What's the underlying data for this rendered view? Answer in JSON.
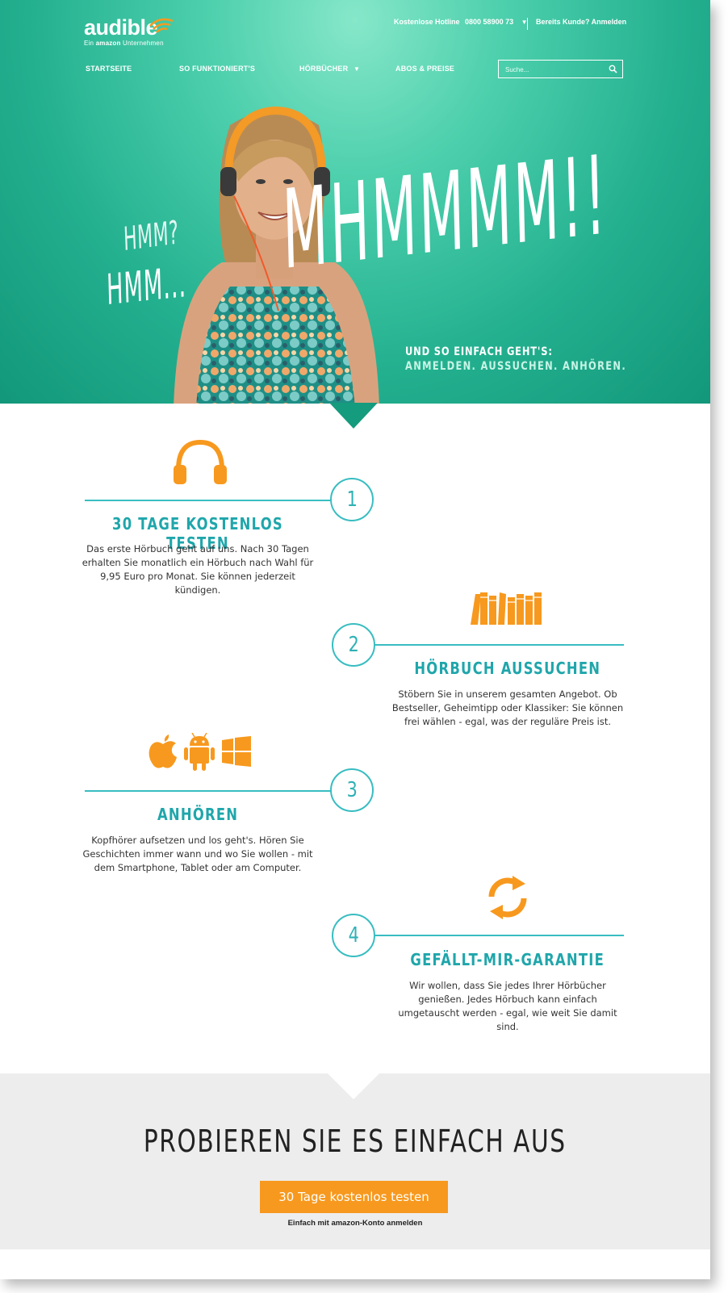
{
  "header": {
    "logo_word": "audible",
    "logo_sub_pre": "Ein",
    "logo_sub_brand": "amazon",
    "logo_sub_post": "Unternehmen",
    "hotline_label": "Kostenlose Hotline",
    "hotline_number": "0800 58900 73",
    "login_label": "Bereits Kunde? Anmelden"
  },
  "nav": {
    "items": [
      "STARTSEITE",
      "SO FUNKTIONIERT'S",
      "HÖRBÜCHER",
      "ABOS & PREISE"
    ],
    "search_placeholder": "Suche..."
  },
  "hero": {
    "hmm_question": "HMM?",
    "hmm_dots": "HMM...",
    "mhm": "MHMMMM!!",
    "tagline_1": "UND SO EINFACH GEHT'S:",
    "tagline_2": "ANMELDEN. AUSSUCHEN. ANHÖREN."
  },
  "steps": [
    {
      "number": "1",
      "title": "30 TAGE KOSTENLOS TESTEN",
      "text": "Das erste Hörbuch geht auf uns. Nach 30 Tagen erhalten Sie monatlich ein Hörbuch nach Wahl für 9,95 Euro pro Monat. Sie können jederzeit kündigen.",
      "icon": "headphones-icon"
    },
    {
      "number": "2",
      "title": "HÖRBUCH AUSSUCHEN",
      "text": "Stöbern Sie in unserem gesamten Angebot. Ob Bestseller, Geheimtipp oder Klassiker: Sie können frei wählen - egal, was der reguläre Preis ist.",
      "icon": "books-icon"
    },
    {
      "number": "3",
      "title": "ANHÖREN",
      "text": "Kopfhörer aufsetzen und los geht's. Hören Sie Geschichten immer wann und wo Sie wollen - mit dem Smartphone, Tablet oder am Computer.",
      "icon": "devices-icons"
    },
    {
      "number": "4",
      "title": "GEFÄLLT-MIR-GARANTIE",
      "text": "Wir wollen, dass Sie jedes Ihrer Hörbücher genießen. Jedes Hörbuch kann einfach umgetauscht werden - egal, wie weit Sie damit sind.",
      "icon": "exchange-icon"
    }
  ],
  "cta": {
    "title": "PROBIEREN SIE ES EINFACH AUS",
    "button": "30 Tage kostenlos testen",
    "note_pre": "Einfach mit",
    "note_brand": "amazon",
    "note_post": "-Konto anmelden"
  },
  "colors": {
    "teal_hero": "#23b08f",
    "teal_accent": "#38bdc1",
    "orange": "#f7991e",
    "cta_bg": "#ededed"
  }
}
